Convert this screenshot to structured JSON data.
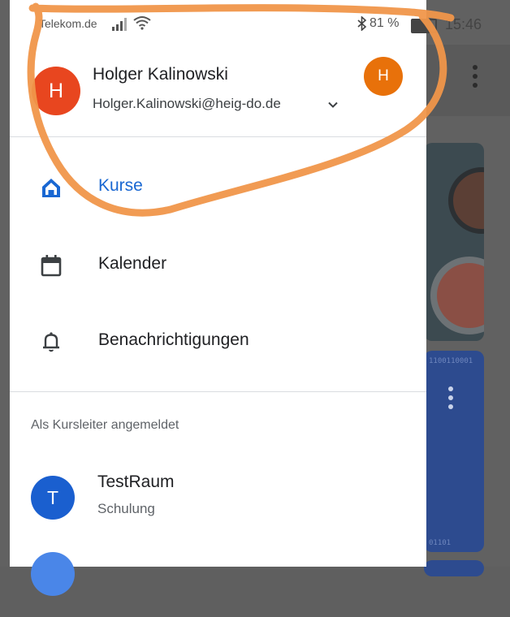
{
  "colors": {
    "accent": "#1967d2",
    "main_avatar": "#e8461f",
    "small_avatar": "#e8710a",
    "course_avatar": "#1a5fcf",
    "annotation": "#f0964a"
  },
  "status_bar": {
    "carrier": "Telekom.de",
    "battery": "81 %",
    "time": "15:46"
  },
  "account": {
    "name": "Holger Kalinowski",
    "email": "Holger.Kalinowski@heig-do.de",
    "avatar_letter": "H",
    "secondary_avatar_letter": "H"
  },
  "nav": {
    "items": [
      {
        "label": "Kurse",
        "icon": "home-icon",
        "active": true
      },
      {
        "label": "Kalender",
        "icon": "calendar-icon",
        "active": false
      },
      {
        "label": "Benachrichtigungen",
        "icon": "bell-icon",
        "active": false
      }
    ]
  },
  "section": {
    "title": "Als Kursleiter angemeldet"
  },
  "courses": [
    {
      "letter": "T",
      "name": "TestRaum",
      "subtitle": "Schulung"
    }
  ],
  "background": {
    "binary_top": "1100110001",
    "binary_bottom": "01101"
  }
}
